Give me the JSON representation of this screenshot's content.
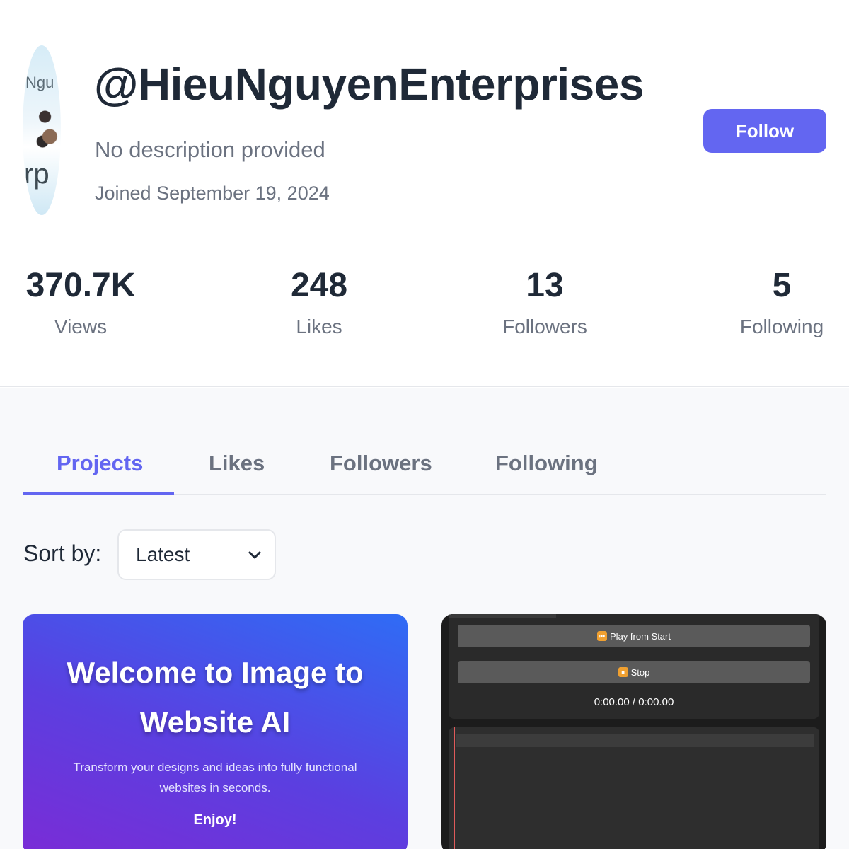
{
  "profile": {
    "username": "@HieuNguyenEnterprises",
    "description": "No description provided",
    "joined": "Joined September 19, 2024",
    "avatar_text_top": "Ngu",
    "avatar_text_bottom": "rp",
    "follow_label": "Follow"
  },
  "stats": [
    {
      "value": "370.7K",
      "label": "Views"
    },
    {
      "value": "248",
      "label": "Likes"
    },
    {
      "value": "13",
      "label": "Followers"
    },
    {
      "value": "5",
      "label": "Following"
    }
  ],
  "tabs": [
    {
      "label": "Projects",
      "active": true
    },
    {
      "label": "Likes",
      "active": false
    },
    {
      "label": "Followers",
      "active": false
    },
    {
      "label": "Following",
      "active": false
    }
  ],
  "sort": {
    "label": "Sort by:",
    "selected": "Latest"
  },
  "projects": [
    {
      "title": "Welcome to Image to Website AI",
      "subtitle": "Transform your designs and ideas into fully functional websites in seconds.",
      "cta": "Enjoy!"
    },
    {
      "play_label": "Play from Start",
      "stop_label": "Stop",
      "time": "0:00.00 / 0:00.00"
    }
  ],
  "colors": {
    "accent": "#6366f1",
    "text_dark": "#1f2937",
    "text_muted": "#6b7280"
  }
}
